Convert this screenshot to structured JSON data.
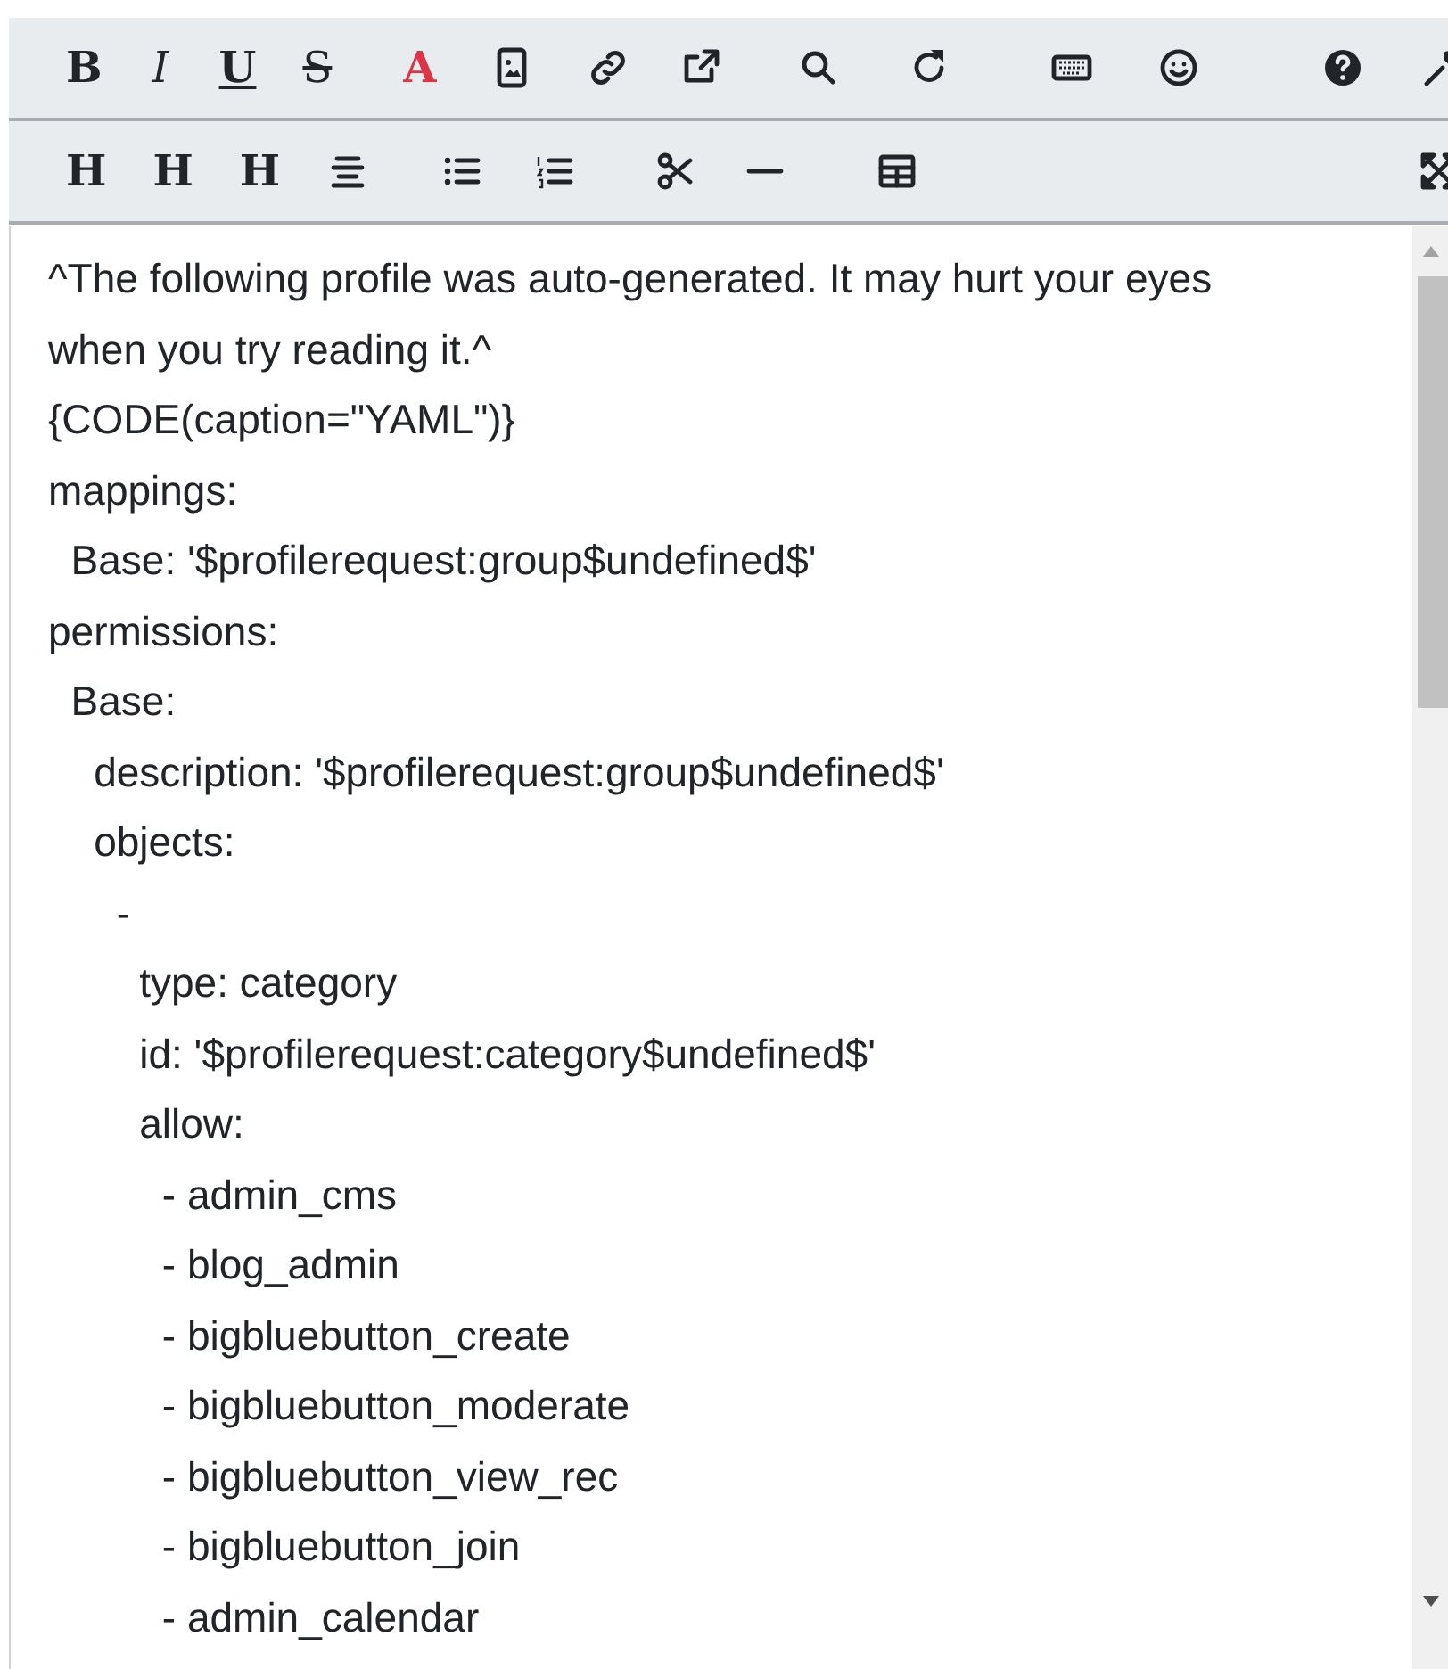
{
  "toolbar_rows": [
    {
      "items": [
        {
          "kind": "text",
          "text": "B"
        },
        {
          "kind": "text",
          "text": "I"
        },
        {
          "kind": "text",
          "text": "U"
        },
        {
          "kind": "text",
          "text": "S"
        },
        {
          "kind": "text",
          "text": "A"
        },
        {
          "kind": "icon"
        },
        {
          "kind": "icon"
        },
        {
          "kind": "icon"
        },
        {
          "kind": "icon"
        },
        {
          "kind": "icon"
        },
        {
          "kind": "icon"
        },
        {
          "kind": "icon"
        },
        {
          "kind": "icon"
        },
        {
          "kind": "icon"
        }
      ]
    },
    {
      "items": [
        {
          "kind": "text",
          "text": "H"
        },
        {
          "kind": "text",
          "text": "H"
        },
        {
          "kind": "text",
          "text": "H"
        },
        {
          "kind": "icon"
        },
        {
          "kind": "icon"
        },
        {
          "kind": "icon"
        },
        {
          "kind": "icon"
        },
        {
          "kind": "icon"
        },
        {
          "kind": "icon"
        },
        {
          "kind": "icon"
        }
      ]
    }
  ],
  "editor_lines": [
    "^The following profile was auto-generated. It may hurt your eyes when you try reading it.^",
    "{CODE(caption=\"YAML\")}",
    "mappings:",
    "  Base: '$profilerequest:group$undefined$'",
    "permissions:",
    "  Base:",
    "    description: '$profilerequest:group$undefined$'",
    "    objects:",
    "      -",
    "        type: category",
    "        id: '$profilerequest:category$undefined$'",
    "        allow:",
    "          - admin_cms",
    "          - blog_admin",
    "          - bigbluebutton_create",
    "          - bigbluebutton_moderate",
    "          - bigbluebutton_view_rec",
    "          - bigbluebutton_join",
    "          - admin_calendar"
  ]
}
